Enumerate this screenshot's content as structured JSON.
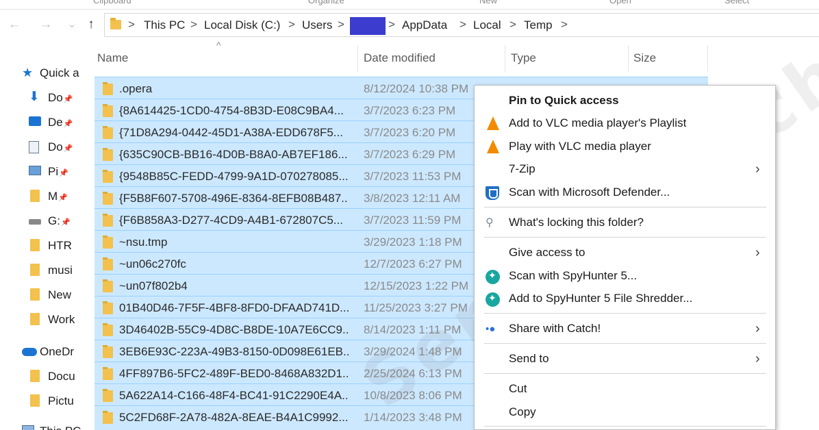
{
  "ribbon": {
    "groups": [
      "Clipboard",
      "Organize",
      "New",
      "Open",
      "Select"
    ]
  },
  "nav": {
    "back": "←",
    "forward": "→",
    "recent": "⌄",
    "up": "↑",
    "breadcrumb": [
      "This PC",
      "Local Disk (C:)",
      "Users",
      "AppData",
      "Local",
      "Temp"
    ],
    "separator": ">"
  },
  "sidebar": {
    "items": [
      {
        "label": "Quick a",
        "icon": "star-icon"
      },
      {
        "label": "Do",
        "icon": "downloads-icon",
        "pin": "📌"
      },
      {
        "label": "De",
        "icon": "desktop-icon",
        "pin": "📌"
      },
      {
        "label": "Do",
        "icon": "documents-icon",
        "pin": "📌"
      },
      {
        "label": "Pi",
        "icon": "pictures-icon",
        "pin": "📌"
      },
      {
        "label": "M",
        "icon": "folder-icon",
        "pin": "📌"
      },
      {
        "label": "G:",
        "icon": "drive-icon",
        "pin": "📌"
      },
      {
        "label": "HTR",
        "icon": "folder-icon"
      },
      {
        "label": "musi",
        "icon": "folder-icon"
      },
      {
        "label": "New",
        "icon": "folder-icon"
      },
      {
        "label": "Work",
        "icon": "folder-icon"
      },
      {
        "label": "OneDr",
        "icon": "onedrive-icon"
      },
      {
        "label": "Docu",
        "icon": "folder-icon"
      },
      {
        "label": "Pictu",
        "icon": "folder-icon"
      },
      {
        "label": "This PC",
        "icon": "computer-icon"
      }
    ]
  },
  "columns": {
    "name": "Name",
    "date": "Date modified",
    "type": "Type",
    "size": "Size",
    "sort_glyph": "^"
  },
  "files": [
    {
      "name": ".opera",
      "date": "8/12/2024 10:38 PM"
    },
    {
      "name": "{8A614425-1CD0-4754-8B3D-E08C9BA4...",
      "date": "3/7/2023 6:23 PM"
    },
    {
      "name": "{71D8A294-0442-45D1-A38A-EDD678F5...",
      "date": "3/7/2023 6:20 PM"
    },
    {
      "name": "{635C90CB-BB16-4D0B-B8A0-AB7EF186...",
      "date": "3/7/2023 6:29 PM"
    },
    {
      "name": "{9548B85C-FEDD-4799-9A1D-070278085...",
      "date": "3/7/2023 11:53 PM"
    },
    {
      "name": "{F5B8F607-5708-496E-8364-8EFB08B487...",
      "date": "3/8/2023 12:11 AM"
    },
    {
      "name": "{F6B858A3-D277-4CD9-A4B1-672807C5...",
      "date": "3/7/2023 11:59 PM"
    },
    {
      "name": "~nsu.tmp",
      "date": "3/29/2023 1:18 PM"
    },
    {
      "name": "~un06c270fc",
      "date": "12/7/2023 6:27 PM"
    },
    {
      "name": "~un07f802b4",
      "date": "12/15/2023 1:22 PM"
    },
    {
      "name": "01B40D46-7F5F-4BF8-8FD0-DFAAD741D...",
      "date": "11/25/2023 3:27 PM"
    },
    {
      "name": "3D46402B-55C9-4D8C-B8DE-10A7E6CC9...",
      "date": "8/14/2023 1:11 PM"
    },
    {
      "name": "3EB6E93C-223A-49B3-8150-0D098E61EB...",
      "date": "3/29/2024 1:48 PM"
    },
    {
      "name": "4FF897B6-5FC2-489F-BED0-8468A832D1...",
      "date": "2/25/2024 6:13 PM"
    },
    {
      "name": "5A622A14-C166-48F4-BC41-91C2290E4A...",
      "date": "10/8/2023 8:06 PM"
    },
    {
      "name": "5C2FD68F-2A78-482A-8EAE-B4A1C9992...",
      "date": "1/14/2023 3:48 PM"
    }
  ],
  "context_menu": {
    "items": [
      {
        "label": "Pin to Quick access",
        "bold": true,
        "icon": ""
      },
      {
        "label": "Add to VLC media player's Playlist",
        "icon": "vlc-icon"
      },
      {
        "label": "Play with VLC media player",
        "icon": "vlc-icon"
      },
      {
        "label": "7-Zip",
        "icon": "",
        "submenu": true
      },
      {
        "label": "Scan with Microsoft Defender...",
        "icon": "defender-icon"
      },
      {
        "label": "What's locking this folder?",
        "icon": "lock-search-icon",
        "divider_before": true
      },
      {
        "label": "Give access to",
        "icon": "",
        "submenu": true,
        "divider_before": true
      },
      {
        "label": "Scan with SpyHunter 5...",
        "icon": "spyhunter-icon"
      },
      {
        "label": "Add to SpyHunter 5 File Shredder...",
        "icon": "spyhunter-icon"
      },
      {
        "label": "Share with Catch!",
        "icon": "catch-icon",
        "submenu": true,
        "divider_before": true
      },
      {
        "label": "Send to",
        "icon": "",
        "submenu": true,
        "divider_before": true
      },
      {
        "label": "Cut",
        "icon": "",
        "divider_before": true
      },
      {
        "label": "Copy",
        "icon": ""
      }
    ],
    "submenu_glyph": "›"
  },
  "watermark": "Sensors TechForum",
  "colors": {
    "selection": "#cce8ff",
    "selection_border": "#99d1ff",
    "folder": "#f2c14e",
    "accent": "#1b74d1",
    "redaction": "#3c3ccf"
  }
}
